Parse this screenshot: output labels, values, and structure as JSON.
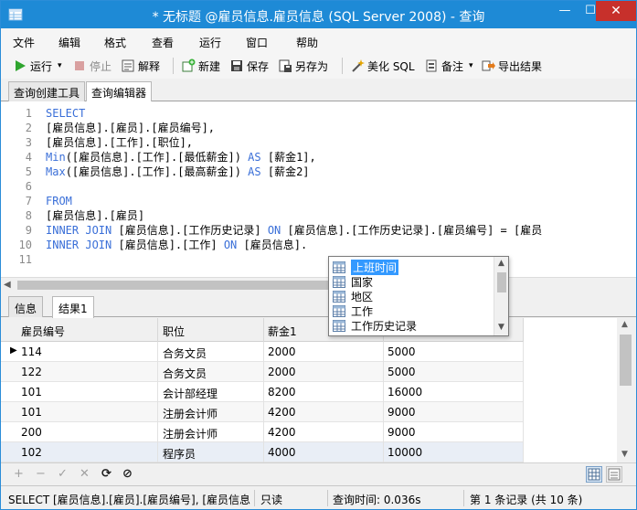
{
  "window": {
    "title": "* 无标题 @雇员信息.雇员信息 (SQL Server 2008) - 查询",
    "min_glyph": "—",
    "max_glyph": "☐",
    "close_glyph": "✕"
  },
  "menu": [
    "文件",
    "编辑",
    "格式",
    "查看",
    "运行",
    "窗口",
    "帮助"
  ],
  "toolbar": {
    "run": "运行",
    "run_dropdown": "▾",
    "stop": "停止",
    "explain": "解释",
    "new": "新建",
    "save": "保存",
    "save_as": "另存为",
    "beautify": "美化 SQL",
    "comment": "备注",
    "comment_dropdown": "▾",
    "export": "导出结果"
  },
  "editor_tabs": [
    "查询创建工具",
    "查询编辑器"
  ],
  "editor": {
    "lines": [
      {
        "n": "1",
        "kw": "SELECT",
        "text": ""
      },
      {
        "n": "2",
        "kw": "",
        "text": "[雇员信息].[雇员].[雇员编号],"
      },
      {
        "n": "3",
        "kw": "",
        "text": "[雇员信息].[工作].[职位],"
      },
      {
        "n": "4",
        "kw": "Min",
        "text": "([雇员信息].[工作].[最低薪金]) ",
        "kw2": "AS",
        "text2": " [薪金1],"
      },
      {
        "n": "5",
        "kw": "Max",
        "text": "([雇员信息].[工作].[最高薪金]) ",
        "kw2": "AS",
        "text2": " [薪金2]"
      },
      {
        "n": "6",
        "kw": "",
        "text": ""
      },
      {
        "n": "7",
        "kw": "FROM",
        "text": ""
      },
      {
        "n": "8",
        "kw": "",
        "text": "[雇员信息].[雇员]"
      },
      {
        "n": "9",
        "kw": "INNER JOIN",
        "text": " [雇员信息].[工作历史记录] ",
        "kw2": "ON",
        "text2": " [雇员信息].[工作历史记录].[雇员编号] = [雇员"
      },
      {
        "n": "10",
        "kw": "INNER JOIN",
        "text": " [雇员信息].[工作] ",
        "kw2": "ON",
        "text2": " [雇员信息]."
      },
      {
        "n": "11",
        "kw": "",
        "text": ""
      }
    ]
  },
  "autocomplete": {
    "items": [
      "上班时间",
      "国家",
      "地区",
      "工作",
      "工作历史记录"
    ],
    "selected_index": 0
  },
  "result_tabs": [
    "信息",
    "结果1"
  ],
  "grid": {
    "columns": [
      "雇员编号",
      "职位",
      "薪金1",
      ""
    ],
    "rows": [
      [
        "114",
        "合务文员",
        "2000",
        "5000"
      ],
      [
        "122",
        "合务文员",
        "2000",
        "5000"
      ],
      [
        "101",
        "会计部经理",
        "8200",
        "16000"
      ],
      [
        "101",
        "注册会计师",
        "4200",
        "9000"
      ],
      [
        "200",
        "注册会计师",
        "4200",
        "9000"
      ],
      [
        "102",
        "程序员",
        "4000",
        "10000"
      ]
    ],
    "current_row": 0
  },
  "grid_toolbar": {
    "add": "+",
    "delete": "−",
    "apply": "✓",
    "discard": "✕",
    "refresh": "⟳",
    "stop": "⊘"
  },
  "statusbar": {
    "sql": "SELECT [雇员信息].[雇员].[雇员编号], [雇员信息].[",
    "mode": "只读",
    "query_time": "查询时间: 0.036s",
    "records": "第 1 条记录 (共 10 条)"
  },
  "colors": {
    "titlebar": "#1e8ad6",
    "keyword": "#3a6fd8",
    "selection": "#3399ff",
    "close": "#c7302b"
  }
}
